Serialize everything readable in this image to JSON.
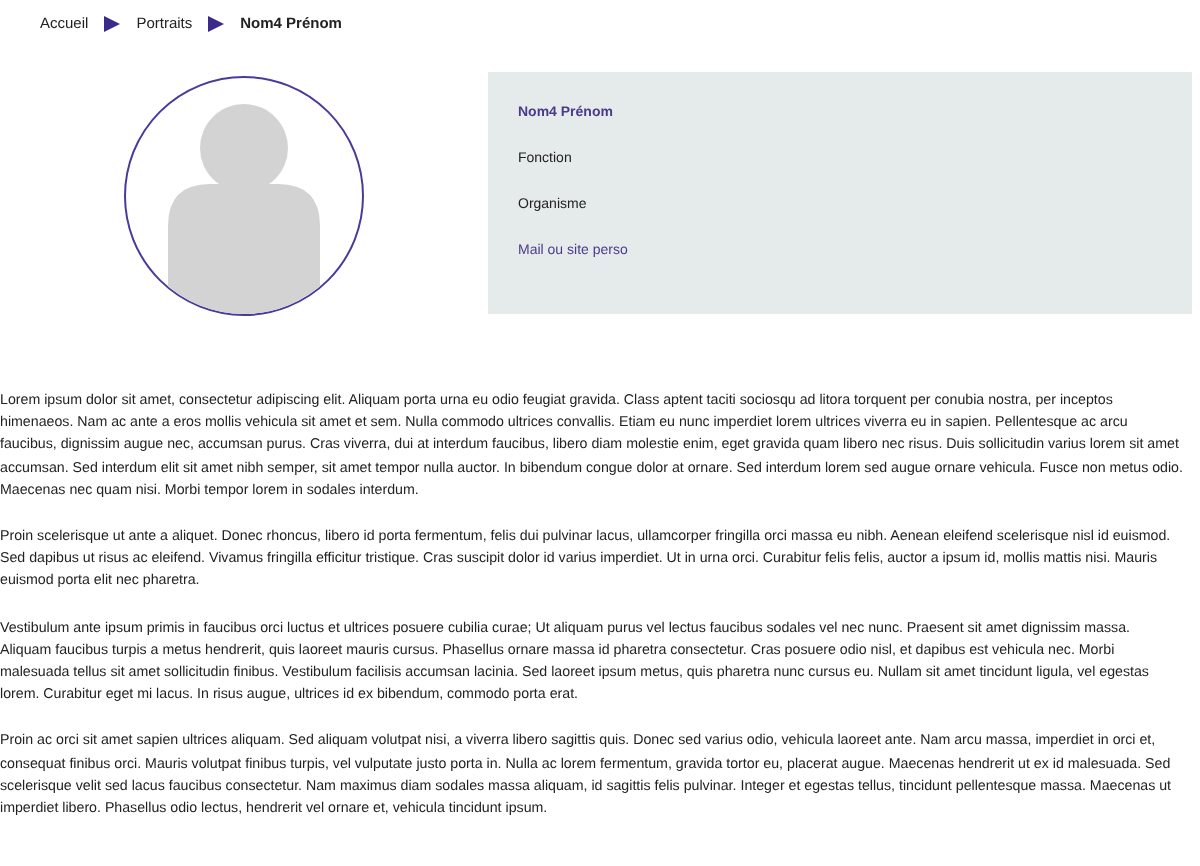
{
  "breadcrumb": [
    {
      "label": "Accueil",
      "current": false
    },
    {
      "label": "Portraits",
      "current": false
    },
    {
      "label": "Nom4 Prénom",
      "current": true
    }
  ],
  "profile": {
    "name": "Nom4 Prénom",
    "function": "Fonction",
    "organization": "Organisme",
    "link": "Mail ou site perso"
  },
  "paragraphs": [
    "Lorem ipsum dolor sit amet, consectetur adipiscing elit. Aliquam porta urna eu odio feugiat gravida. Class aptent taciti sociosqu ad litora torquent per conubia nostra, per inceptos himenaeos. Nam ac ante a eros mollis vehicula sit amet et sem. Nulla commodo ultrices convallis. Etiam eu nunc imperdiet lorem ultrices viverra eu in sapien. Pellentesque ac arcu faucibus, dignissim augue nec, accumsan purus. Cras viverra, dui at interdum faucibus, libero diam molestie enim, eget gravida quam libero nec risus. Duis sollicitudin varius lorem sit amet accumsan. Sed interdum elit sit amet nibh semper, sit amet tempor nulla auctor. In bibendum congue dolor at ornare. Sed interdum lorem sed augue ornare vehicula. Fusce non metus odio. Maecenas nec quam nisi. Morbi tempor lorem in sodales interdum.",
    "Proin scelerisque ut ante a aliquet. Donec rhoncus, libero id porta fermentum, felis dui pulvinar lacus, ullamcorper fringilla orci massa eu nibh. Aenean eleifend scelerisque nisl id euismod. Sed dapibus ut risus ac eleifend. Vivamus fringilla efficitur tristique. Cras suscipit dolor id varius imperdiet. Ut in urna orci. Curabitur felis felis, auctor a ipsum id, mollis mattis nisi. Mauris euismod porta elit nec pharetra.",
    "Vestibulum ante ipsum primis in faucibus orci luctus et ultrices posuere cubilia curae; Ut aliquam purus vel lectus faucibus sodales vel nec nunc. Praesent sit amet dignissim massa. Aliquam faucibus turpis a metus hendrerit, quis laoreet mauris cursus. Phasellus ornare massa id pharetra consectetur. Cras posuere odio nisl, et dapibus est vehicula nec. Morbi malesuada tellus sit amet sollicitudin finibus. Vestibulum facilisis accumsan lacinia. Sed laoreet ipsum metus, quis pharetra nunc cursus eu. Nullam sit amet tincidunt ligula, vel egestas lorem. Curabitur eget mi lacus. In risus augue, ultrices id ex bibendum, commodo porta erat.",
    "Proin ac orci sit amet sapien ultrices aliquam. Sed aliquam volutpat nisi, a viverra libero sagittis quis. Donec sed varius odio, vehicula laoreet ante. Nam arcu massa, imperdiet in orci et, consequat finibus orci. Mauris volutpat finibus turpis, vel vulputate justo porta in. Nulla ac lorem fermentum, gravida tortor eu, placerat augue. Maecenas hendrerit ut ex id malesuada. Sed scelerisque velit sed lacus faucibus consectetur. Nam maximus diam sodales massa aliquam, id sagittis felis pulvinar. Integer et egestas tellus, tincidunt pellentesque massa. Maecenas ut imperdiet libero. Phasellus odio lectus, hendrerit vel ornare et, vehicula tincidunt ipsum."
  ]
}
